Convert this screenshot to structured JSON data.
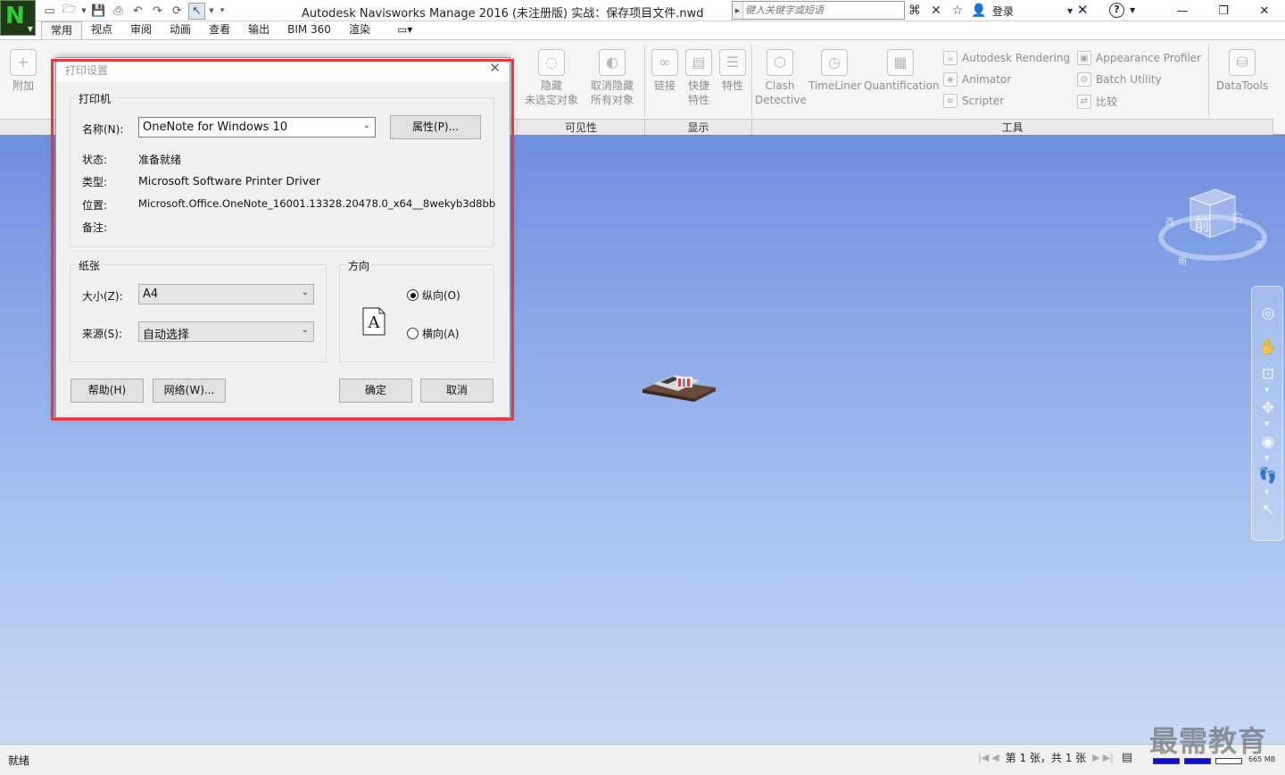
{
  "titlebar": {
    "title": "Autodesk Navisworks Manage 2016 (未注册版)      实战：保存项目文件.nwd",
    "search_placeholder": "键入关键字或短语",
    "login_label": "登录"
  },
  "tabs": [
    "常用",
    "视点",
    "审阅",
    "动画",
    "查看",
    "输出",
    "BIM 360",
    "渲染"
  ],
  "ribbon": {
    "append_label": "附加",
    "hide_unselected": [
      "隐藏",
      "未选定对象"
    ],
    "unhide_all": [
      "取消隐藏",
      "所有对象"
    ],
    "links_label": "链接",
    "quick_properties": [
      "快捷",
      "特性"
    ],
    "properties_label": "特性",
    "clash": [
      "Clash",
      "Detective"
    ],
    "timeliner": "TimeLiner",
    "quantification": "Quantification",
    "autodesk_rendering": "Autodesk Rendering",
    "animator": "Animator",
    "scripter": "Scripter",
    "appearance_profiler": "Appearance Profiler",
    "batch_utility": "Batch Utility",
    "compare": "比较",
    "datatools": "DataTools",
    "group_visibility": "可见性",
    "group_display": "显示",
    "group_tools": "工具"
  },
  "viewcube": {
    "front": "前",
    "right": "右",
    "east": "东",
    "west": "西",
    "south": "南"
  },
  "dialog": {
    "title": "打印设置",
    "printer_group": "打印机",
    "name_label": "名称(N):",
    "printer_name": "OneNote for Windows 10",
    "properties_button": "属性(P)...",
    "status_label": "状态:",
    "status_value": "准备就绪",
    "type_label": "类型:",
    "type_value": "Microsoft Software Printer Driver",
    "location_label": "位置:",
    "location_value": "Microsoft.Office.OneNote_16001.13328.20478.0_x64__8wekyb3d8bb",
    "comment_label": "备注:",
    "paper_group": "纸张",
    "size_label": "大小(Z):",
    "size_value": "A4",
    "source_label": "来源(S):",
    "source_value": "自动选择",
    "orientation_group": "方向",
    "orient_glyph": "A",
    "portrait_label": "纵向(O)",
    "landscape_label": "横向(A)",
    "orientation_selected": "portrait",
    "help_button": "帮助(H)",
    "network_button": "网络(W)...",
    "ok_button": "确定",
    "cancel_button": "取消"
  },
  "statusbar": {
    "status": "就绪",
    "sheet": "第 1 张，共 1 张",
    "memory": "665 MB"
  },
  "watermark": "最需教育",
  "colors": {
    "highlight": "#e8383e",
    "viewport_top": "#6f8fe0",
    "viewport_bottom": "#c7d9f5",
    "logo_green": "#2fd12f"
  }
}
